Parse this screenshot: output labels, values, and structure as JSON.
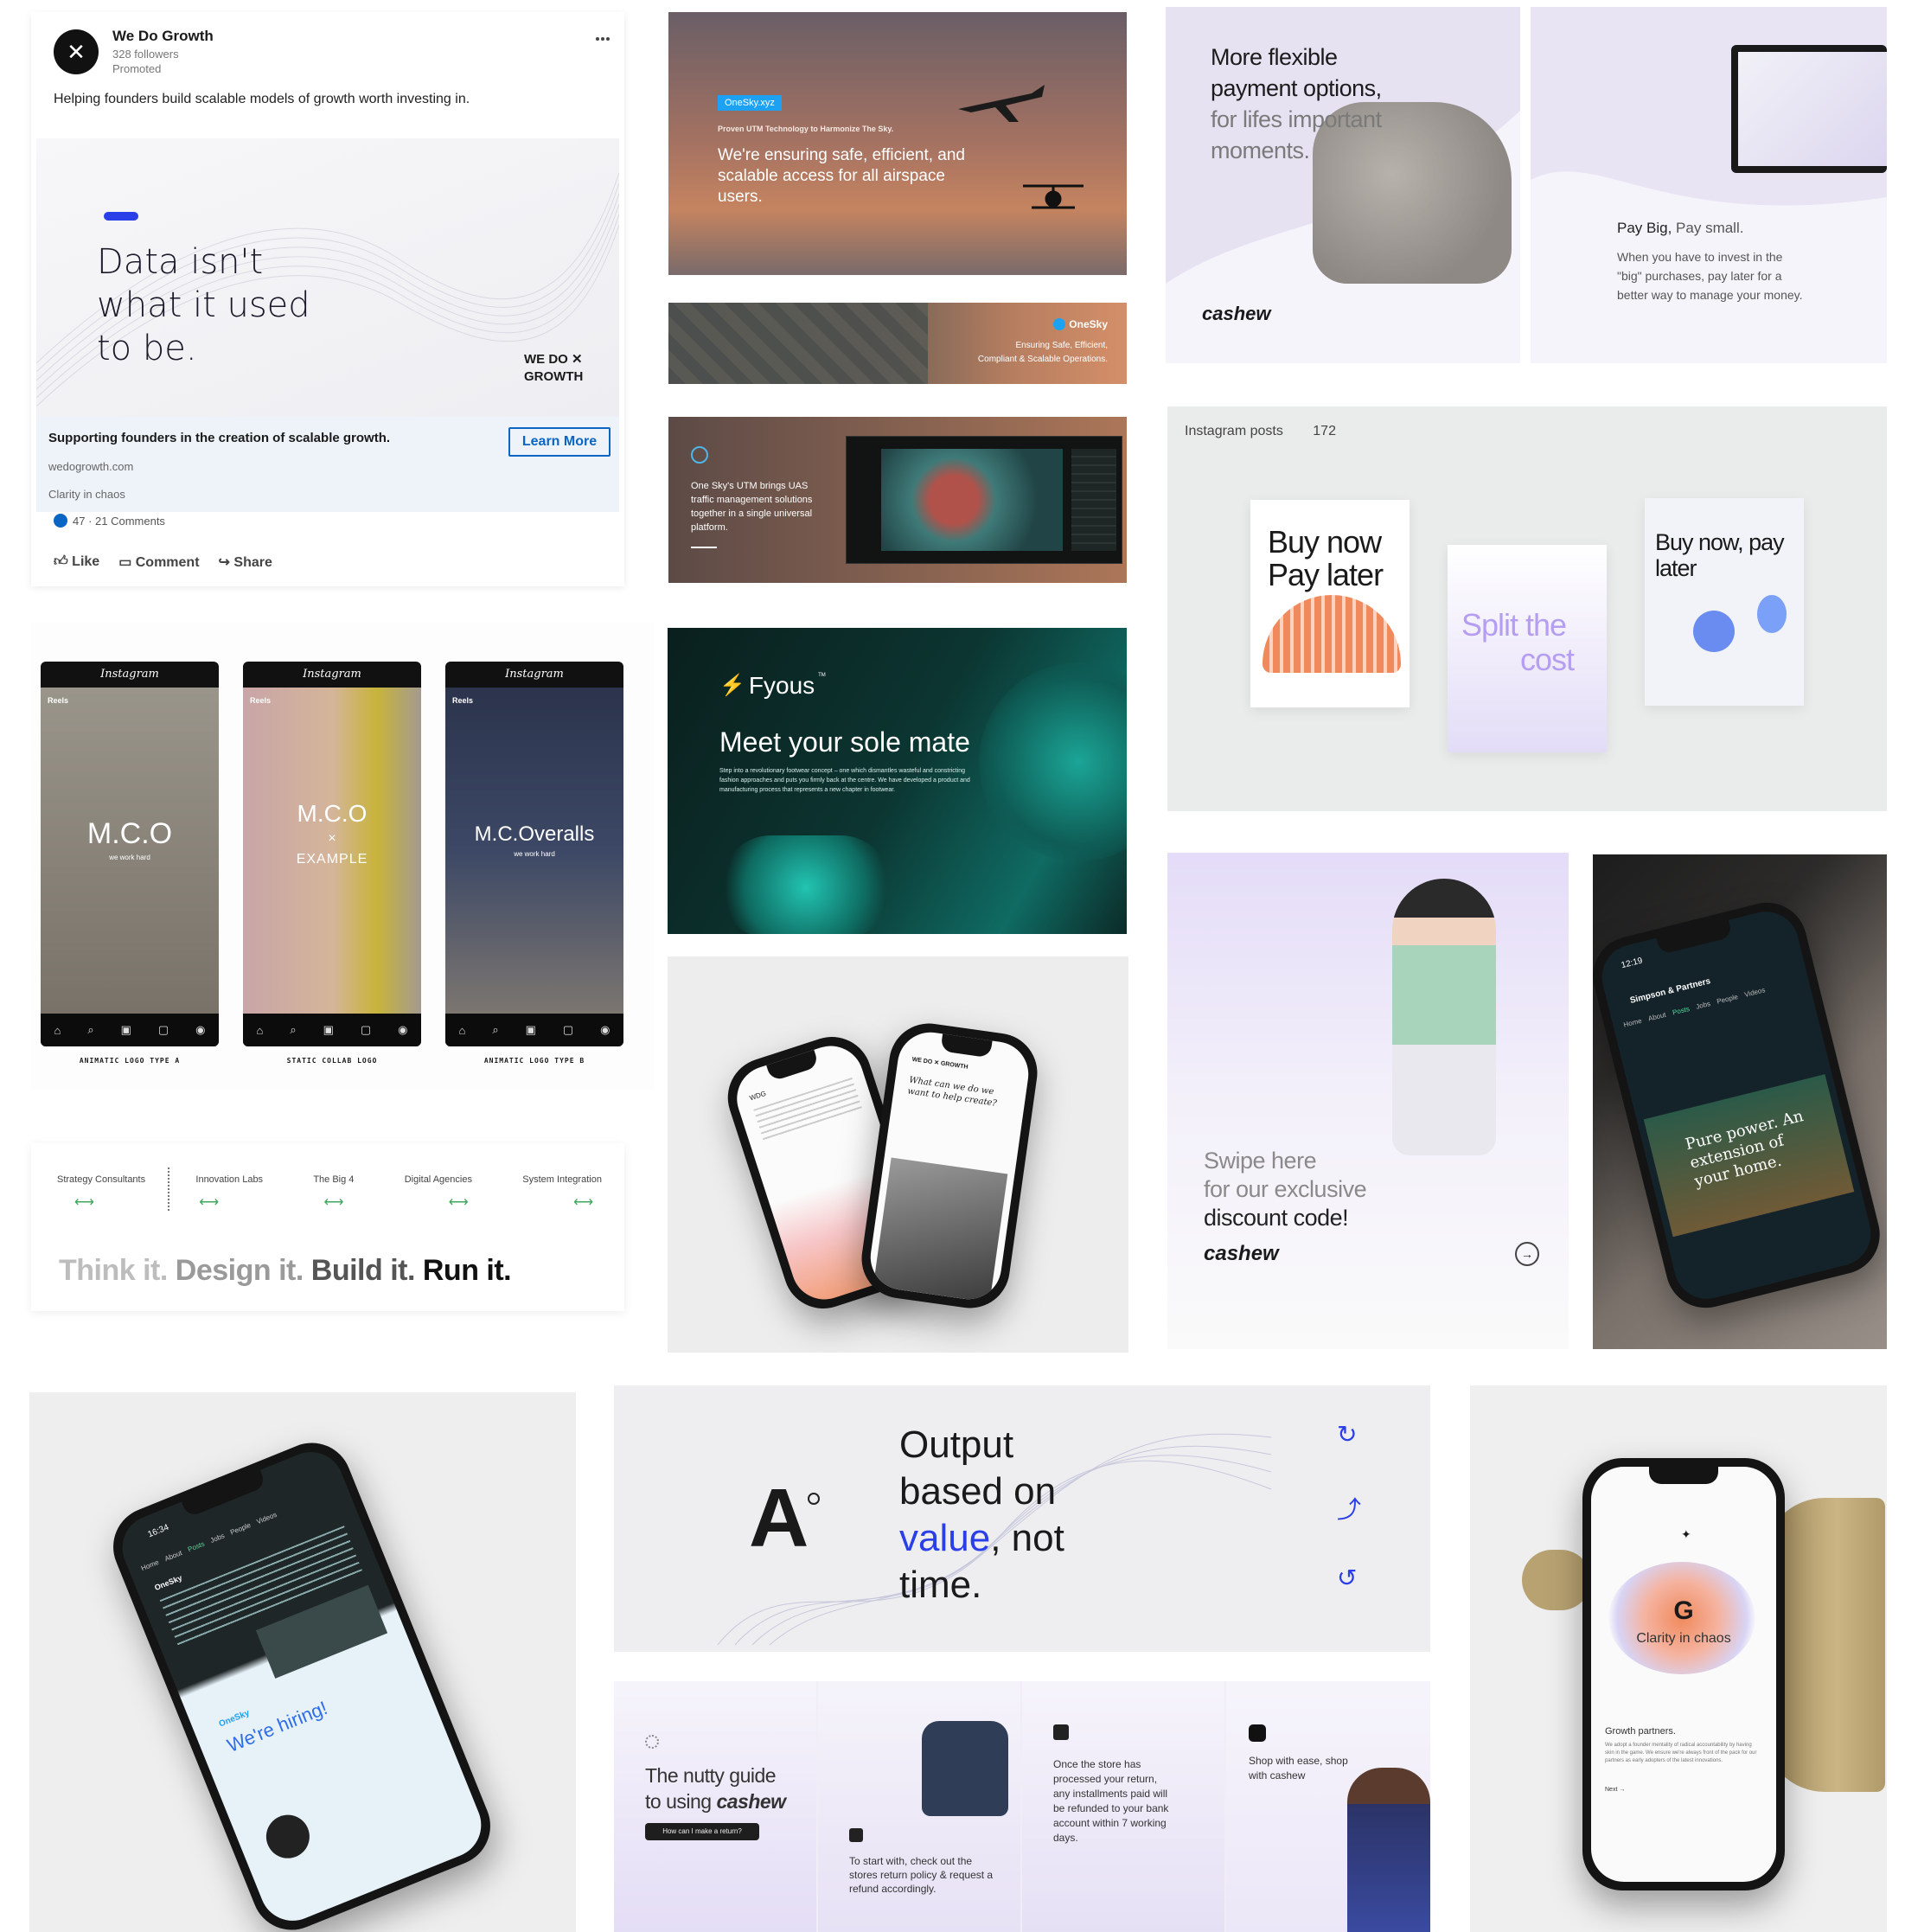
{
  "linkedin": {
    "company": "We Do Growth",
    "followers": "328 followers",
    "promoted": "Promoted",
    "body": "Helping founders build scalable models of growth worth investing in.",
    "badge": "",
    "headline": [
      "Data isn't",
      "what it used",
      "to be."
    ],
    "brand_line1": "WE DO ✕",
    "brand_line2": "GROWTH",
    "cta_title": "Supporting founders in the creation of scalable growth.",
    "cta_url": "wedogrowth.com",
    "cta_tagline": "Clarity in chaos",
    "cta_button": "Learn More",
    "reactions": "47 · 21 Comments",
    "actions": {
      "like": "Like",
      "comment": "Comment",
      "share": "Share"
    }
  },
  "onesky": {
    "tag": "OneSky.xyz",
    "kicker": "Proven UTM Technology to Harmonize The Sky.",
    "headline": "We're ensuring safe, efficient, and scalable access for all airspace users.",
    "banner_brand": "OneSky",
    "banner_line1": "Ensuring Safe, Efficient,",
    "banner_line2": "Compliant & Scalable Operations.",
    "platform_text": "One Sky's UTM brings UAS traffic management solutions together in a single universal platform."
  },
  "cashew_hero": {
    "headline_bold": "More flexible payment options,",
    "headline_light": "for lifes important moments.",
    "brand": "cashew",
    "pay_title_bold": "Pay Big,",
    "pay_title_light": "Pay small.",
    "pay_body": "When you have to invest in the \"big\" purchases, pay later for a better way to manage your money."
  },
  "instagram_posts": {
    "label": "Instagram posts",
    "count": "172",
    "post1": "Buy now Pay later",
    "post2_a": "Split the",
    "post2_b": "cost",
    "post3": "Buy now, pay later"
  },
  "reels": [
    {
      "brand": "Instagram",
      "tab": "Reels",
      "title": "M.C.O",
      "sub": "we work hard",
      "extra": "",
      "caption": "ANIMATIC LOGO TYPE A"
    },
    {
      "brand": "Instagram",
      "tab": "Reels",
      "title": "M.C.O",
      "sub": "×",
      "extra": "EXAMPLE",
      "caption": "STATIC COLLAB LOGO"
    },
    {
      "brand": "Instagram",
      "tab": "Reels",
      "title": "M.C.Overalls",
      "sub": "we work hard",
      "extra": "",
      "caption": "ANIMATIC LOGO TYPE B"
    }
  ],
  "fyous": {
    "brand": "Fyous",
    "tm": "TM",
    "headline": "Meet your sole mate",
    "body": "Step into a revolutionary footwear concept – one which dismantles wasteful and constricting fashion approaches and puts you firmly back at the centre. We have developed a product and manufacturing process that represents a new chapter in footwear."
  },
  "strategy": {
    "items": [
      "Strategy Consultants",
      "Innovation Labs",
      "The Big 4",
      "Digital Agencies",
      "System Integration"
    ],
    "tagline": [
      "Think it.",
      "Design it.",
      "Build it.",
      "Run it."
    ]
  },
  "wdg_phones": {
    "left_header": "WDG",
    "right_header": "WE DO ✕ GROWTH",
    "right_q": "What can we do we want to help create?"
  },
  "swipe": {
    "line1": "Swipe here",
    "line2": "for our exclusive",
    "line3": "discount code!",
    "brand": "cashew"
  },
  "green_phone": {
    "time": "12:19",
    "company": "Simpson & Partners",
    "tabs": [
      "Home",
      "About",
      "Posts",
      "Jobs",
      "People",
      "Videos"
    ],
    "headline": "Pure power. An extension of your home."
  },
  "hiring_phone": {
    "time": "16:34",
    "tabs": [
      "Home",
      "About",
      "Posts",
      "Jobs",
      "People",
      "Videos"
    ],
    "company": "OneSky",
    "brand": "OneSky",
    "headline": "We're hiring!"
  },
  "output": {
    "glyph": "A",
    "line1": "Output",
    "line2": "based on",
    "accent": "value",
    "line3_rest": ", not",
    "line4": "time."
  },
  "nutty": {
    "title_a": "The nutty guide",
    "title_b": "to using",
    "brand": "cashew",
    "pill": "How can I make a return?",
    "step1": "To start with, check out the stores return policy & request a refund accordingly.",
    "step2": "Once the store has processed your return, any installments paid will be refunded to your bank account within 7 working days.",
    "step3": "Shop with ease, shop with cashew"
  },
  "chaos_phone": {
    "letter": "G",
    "tagline": "Clarity in chaos",
    "section": "Growth partners.",
    "body": "We adopt a founder mentality of radical accountability by having skin in the game. We ensure we're always front of the pack for our partners as early adopters of the latest innovations.",
    "link": "Next →"
  },
  "colors": {
    "accent_blue": "#2b3fe8",
    "linkedin_blue": "#0a66c2",
    "lavender": "#e5e1f5",
    "teal": "#0fa896",
    "orange": "#f08a5d"
  }
}
